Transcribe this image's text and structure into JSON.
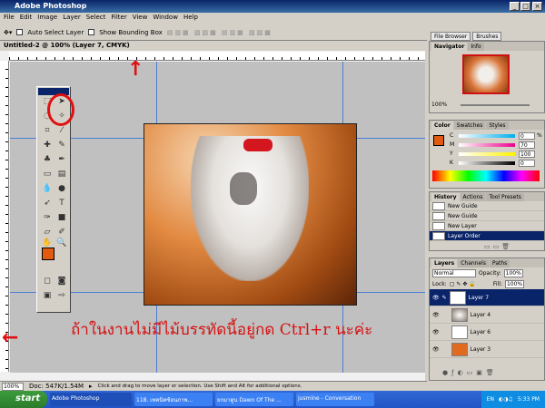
{
  "app": {
    "title": "Adobe Photoshop"
  },
  "menu": [
    "File",
    "Edit",
    "Image",
    "Layer",
    "Select",
    "Filter",
    "View",
    "Window",
    "Help"
  ],
  "options": {
    "auto_select": "Auto Select Layer",
    "bounding": "Show Bounding Box"
  },
  "dock": {
    "tabs": [
      "File Browser",
      "Brushes"
    ]
  },
  "document": {
    "title": "Untitled-2 @ 100% (Layer 7, CMYK)"
  },
  "navigator": {
    "tabs": [
      "Navigator",
      "Info"
    ],
    "zoom": "100%"
  },
  "color": {
    "tabs": [
      "Color",
      "Swatches",
      "Styles"
    ],
    "channels": [
      {
        "label": "C",
        "value": "0",
        "color": "#00aeef"
      },
      {
        "label": "M",
        "value": "70",
        "color": "#ec008c"
      },
      {
        "label": "Y",
        "value": "100",
        "color": "#fff200"
      },
      {
        "label": "K",
        "value": "0",
        "color": "#000000"
      }
    ],
    "pct": "%"
  },
  "history": {
    "tabs": [
      "History",
      "Actions",
      "Tool Presets"
    ],
    "items": [
      "New Guide",
      "New Guide",
      "New Layer",
      "Layer Order"
    ]
  },
  "layers": {
    "tabs": [
      "Layers",
      "Channels",
      "Paths"
    ],
    "mode": "Normal",
    "opacity_label": "Opacity:",
    "opacity": "100%",
    "lock_label": "Lock:",
    "fill_label": "Fill:",
    "fill": "100%",
    "items": [
      "Layer 7",
      "Layer 4",
      "Layer 6",
      "Layer 3"
    ]
  },
  "status": {
    "zoom": "100%",
    "doc": "Doc: 547K/1.54M",
    "hint": "Click and drag to move layer or selection. Use Shift and Alt for additional options."
  },
  "annotation": {
    "text": "ถ้าในงานไม่มีไม้บรรทัดนี้อยู่กด Ctrl+r นะค่ะ"
  },
  "taskbar": {
    "start": "start",
    "tasks": [
      "Adobe Photoshop",
      "118. เทคนิคซ้อนภาพ...",
      "ยกมาดูน Dawn Of The ...",
      "jusmine - Conversation"
    ],
    "lang": "EN",
    "time": "5:33 PM"
  }
}
